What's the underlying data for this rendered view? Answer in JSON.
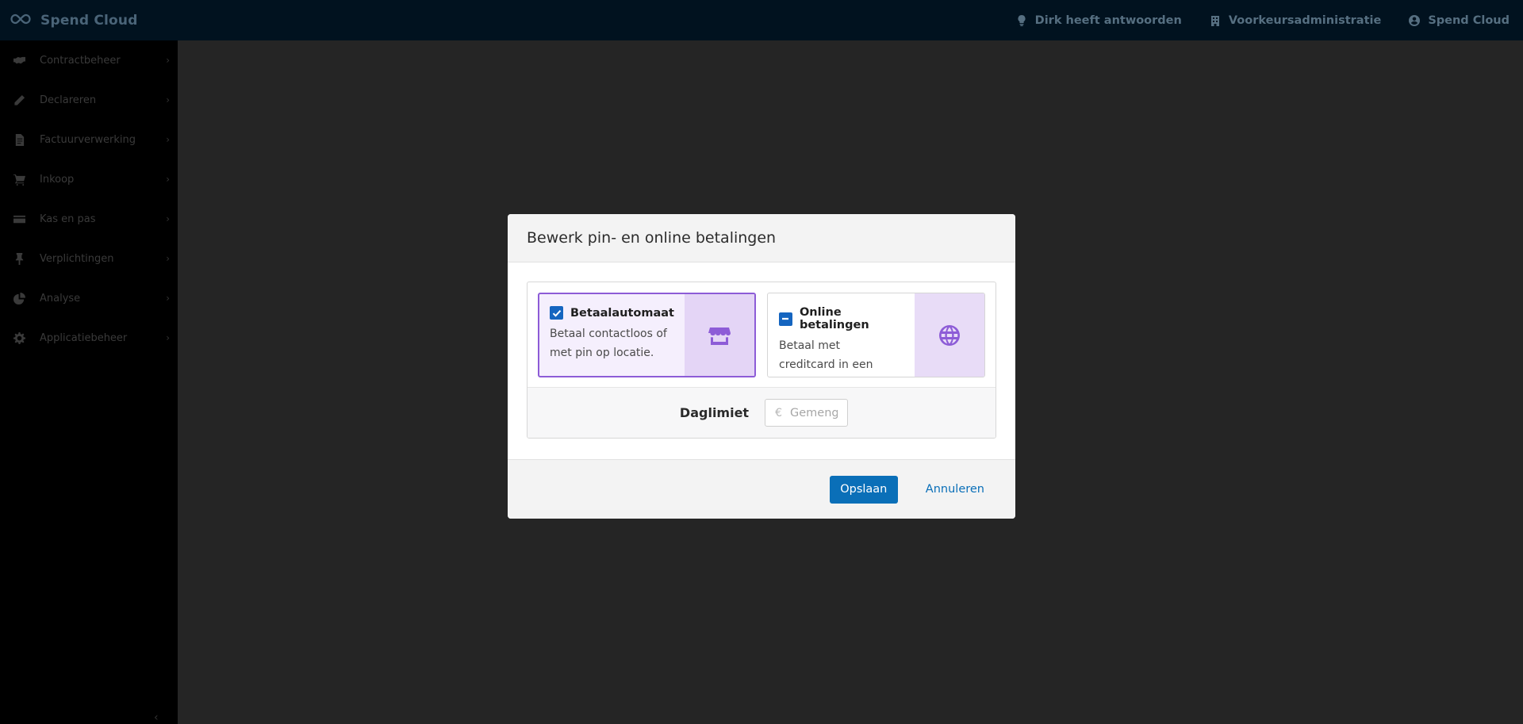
{
  "app": {
    "brand": "Spend Cloud",
    "brand_icon": "infinity-logo-icon"
  },
  "topbar": {
    "items": [
      {
        "label": "Dirk heeft antwoorden",
        "icon": "bulb-icon"
      },
      {
        "label": "Voorkeursadministratie",
        "icon": "building-icon"
      },
      {
        "label": "Spend Cloud",
        "icon": "user-icon"
      }
    ]
  },
  "sidebar": {
    "items": [
      {
        "label": "Contractbeheer",
        "icon": "handshake-icon"
      },
      {
        "label": "Declareren",
        "icon": "pencil-icon"
      },
      {
        "label": "Factuurverwerking",
        "icon": "document-icon"
      },
      {
        "label": "Inkoop",
        "icon": "cart-icon"
      },
      {
        "label": "Kas en pas",
        "icon": "card-icon"
      },
      {
        "label": "Verplichtingen",
        "icon": "pin-icon"
      },
      {
        "label": "Analyse",
        "icon": "pie-chart-icon"
      },
      {
        "label": "Applicatiebeheer",
        "icon": "gear-icon"
      }
    ],
    "collapse_symbol": "‹"
  },
  "modal": {
    "title": "Bewerk pin- en online betalingen",
    "cards": [
      {
        "title": "Betaalautomaat",
        "description": "Betaal contactloos of met pin op locatie.",
        "state": "checked",
        "icon": "store-icon"
      },
      {
        "title": "Online betalingen",
        "description": "Betaal met creditcard in een webwinkel of app.",
        "state": "indeterminate",
        "icon": "globe-icon"
      }
    ],
    "limit": {
      "label": "Daglimiet",
      "currency": "€",
      "placeholder": "Gemengd"
    },
    "save_label": "Opslaan",
    "cancel_label": "Annuleren"
  },
  "colors": {
    "accent": "#8d5cd7",
    "primary": "#0a6fb8",
    "topbar": "#01121f"
  }
}
